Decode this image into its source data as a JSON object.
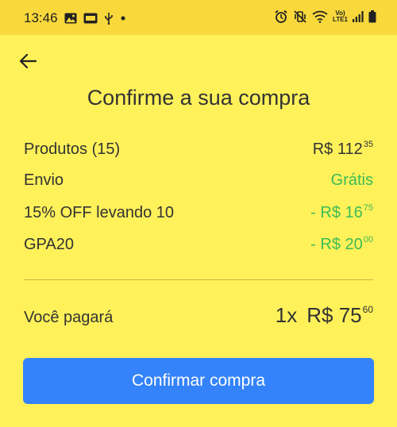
{
  "status_bar": {
    "time": "13:46",
    "network_label_top": "Vo)",
    "network_label_bottom": "LTE1"
  },
  "header": {
    "title": "Confirme a sua compra"
  },
  "summary": {
    "rows": [
      {
        "label": "Produtos (15)",
        "value_main": "R$ 112",
        "value_cents": "35",
        "highlight": false
      },
      {
        "label": "Envio",
        "value_main": "Grátis",
        "value_cents": "",
        "highlight": true
      },
      {
        "label": "15% OFF levando 10",
        "value_main": "- R$ 16",
        "value_cents": "75",
        "highlight": true
      },
      {
        "label": "GPA20",
        "value_main": "- R$ 20",
        "value_cents": "00",
        "highlight": true
      }
    ]
  },
  "total": {
    "label": "Você pagará",
    "installments": "1x",
    "value_main": "R$ 75",
    "value_cents": "60"
  },
  "confirm_button": {
    "label": "Confirmar compra"
  },
  "colors": {
    "background": "#FFF15A",
    "status_bar": "#F9D83C",
    "discount_green": "#3DBB56",
    "button_blue": "#3483FA"
  }
}
